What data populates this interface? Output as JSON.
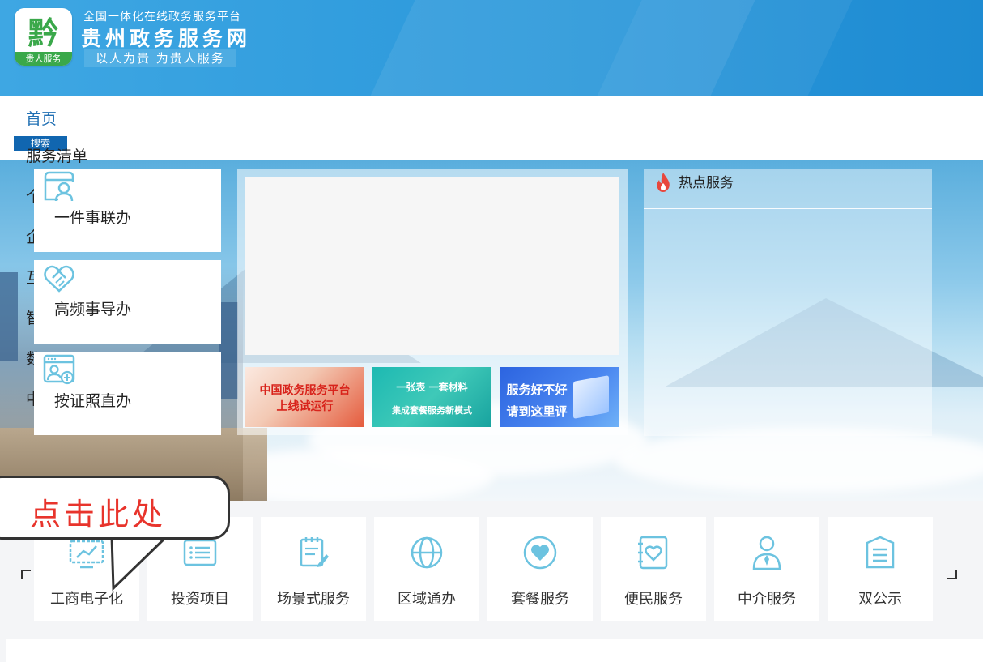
{
  "header": {
    "logo_char": "黔",
    "logo_tag": "贵人服务",
    "subtitle": "全国一体化在线政务服务平台",
    "site_name": "贵州政务服务网",
    "slogan": "以人为贵  为贵人服务"
  },
  "nav": {
    "home": "首页",
    "search_label": "搜索",
    "items": [
      "服务清单",
      "个",
      "企",
      "互",
      "智",
      "数",
      "中"
    ]
  },
  "quick_cards": [
    {
      "label": "一件事联办",
      "icon": "person-window-icon"
    },
    {
      "label": "高频事导办",
      "icon": "handshake-icon"
    },
    {
      "label": "按证照直办",
      "icon": "id-card-plus-icon"
    }
  ],
  "promos": [
    {
      "line1": "中国政务服务平台",
      "line2": "上线试运行"
    },
    {
      "line1": "一张表 一套材料",
      "line2": "集成套餐服务新模式"
    },
    {
      "line1": "服务好不好",
      "line2": "请到这里评"
    }
  ],
  "hot_services": {
    "title": "热点服务",
    "icon": "flame-icon"
  },
  "services": [
    {
      "label": "工商电子化",
      "icon": "monitor-chart-icon"
    },
    {
      "label": "投资项目",
      "icon": "list-card-icon"
    },
    {
      "label": "场景式服务",
      "icon": "notepad-pen-icon"
    },
    {
      "label": "区域通办",
      "icon": "globe-icon"
    },
    {
      "label": "套餐服务",
      "icon": "heart-circle-icon"
    },
    {
      "label": "便民服务",
      "icon": "heart-document-icon"
    },
    {
      "label": "中介服务",
      "icon": "person-tie-icon"
    },
    {
      "label": "双公示",
      "icon": "document-lines-icon"
    }
  ],
  "callout": {
    "text": "点击此处"
  },
  "colors": {
    "accent": "#2a97da",
    "icon": "#6cc3e0",
    "callout": "#e8342c",
    "nav_active": "#1f6fb3"
  }
}
